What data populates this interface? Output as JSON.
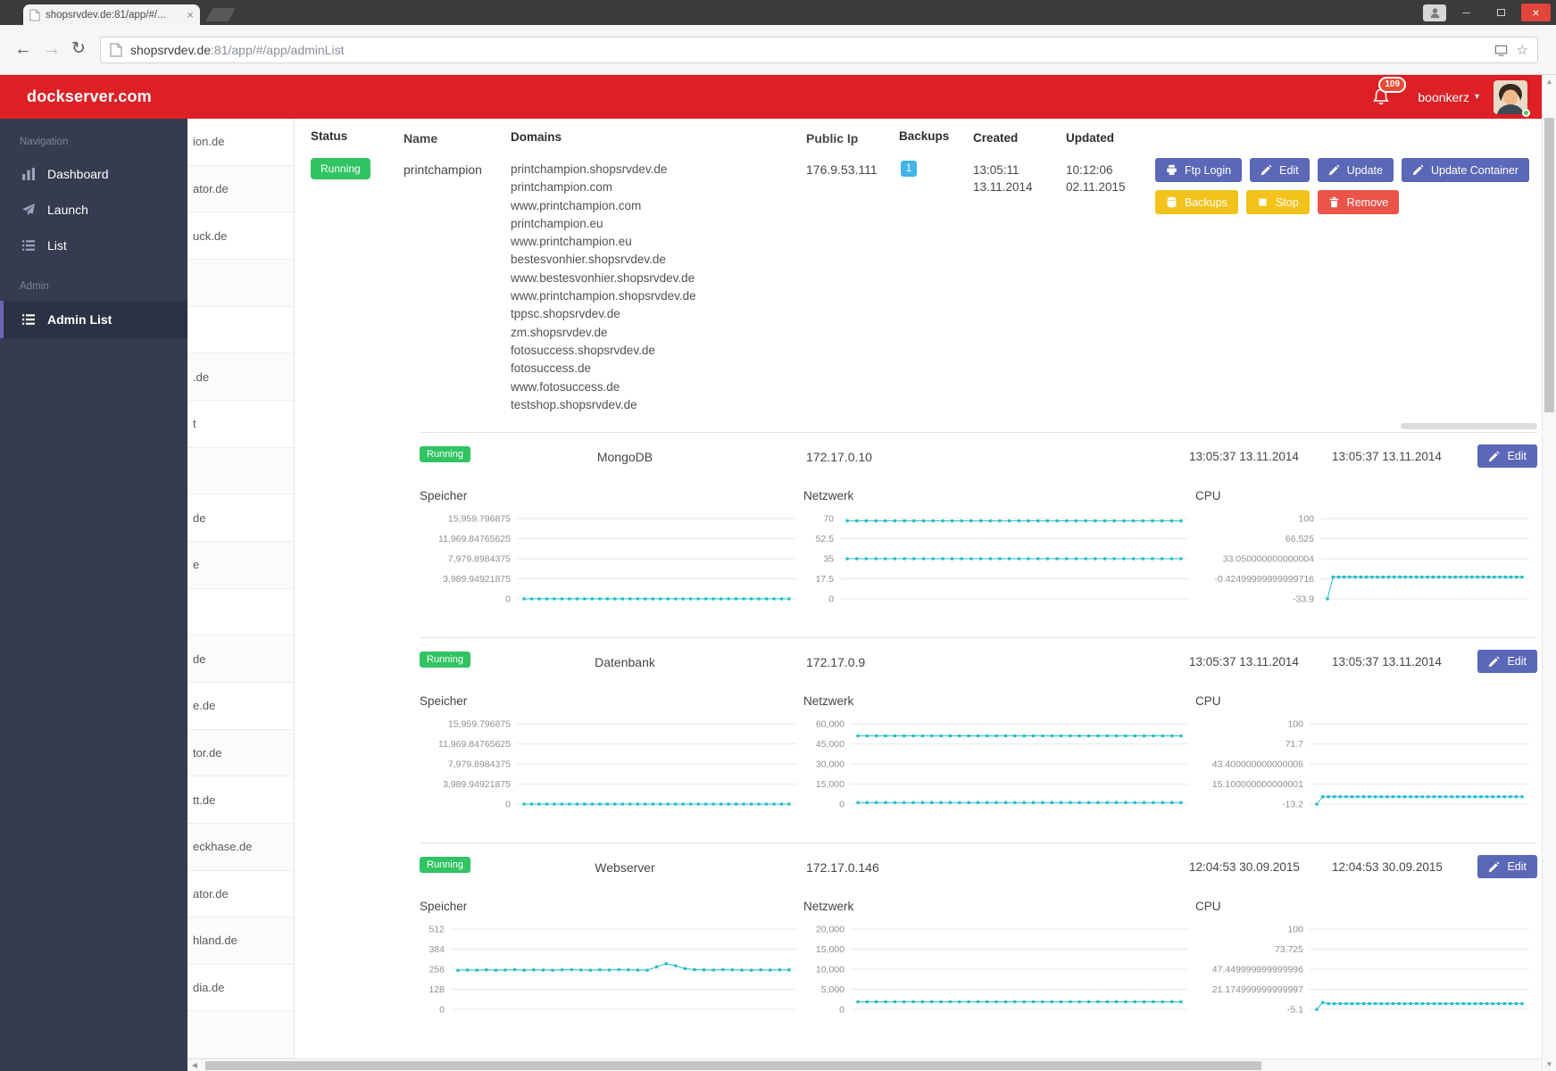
{
  "colors": {
    "brand_red": "#dd2025",
    "accent_purple": "#6f63b8",
    "button_purple": "#5b67b7",
    "button_yellow": "#f3c31c",
    "button_red": "#eb5449",
    "green": "#31c462",
    "teal": "#23bdc9",
    "backup_blue": "#43b5e8"
  },
  "browser": {
    "tab_title": "shopsrvdev.de:81/app/#/...",
    "url_host": "shopsrvdev.de",
    "url_rest": ":81/app/#/app/adminList"
  },
  "header": {
    "brand": "dockserver.com",
    "notification_count": "109",
    "user_name": "boonkerz"
  },
  "sidebar": {
    "sections": [
      {
        "label": "Navigation",
        "items": [
          {
            "label": "Dashboard",
            "icon": "dashboard",
            "active": false
          },
          {
            "label": "Launch",
            "icon": "launch",
            "active": false
          },
          {
            "label": "List",
            "icon": "list",
            "active": false
          }
        ]
      },
      {
        "label": "Admin",
        "items": [
          {
            "label": "Admin List",
            "icon": "list",
            "active": true
          }
        ]
      }
    ]
  },
  "app_list": [
    "ion.de",
    "ator.de",
    "uck.de",
    "",
    "",
    ".de",
    "t",
    "",
    "de",
    "e",
    "",
    "de",
    "e.de",
    "tor.de",
    "tt.de",
    "eckhase.de",
    "ator.de",
    "hland.de",
    "dia.de",
    ""
  ],
  "table": {
    "headers": [
      "Status",
      "Name",
      "Domains",
      "Public Ip",
      "Backups",
      "Created",
      "Updated"
    ],
    "row": {
      "status": "Running",
      "name": "printchampion",
      "domains": [
        "printchampion.shopsrvdev.de",
        "printchampion.com",
        "www.printchampion.com",
        "printchampion.eu",
        "www.printchampion.eu",
        "bestesvonhier.shopsrvdev.de",
        "www.bestesvonhier.shopsrvdev.de",
        "www.printchampion.shopsrvdev.de",
        "tppsc.shopsrvdev.de",
        "zm.shopsrvdev.de",
        "fotosuccess.shopsrvdev.de",
        "fotosuccess.de",
        "www.fotosuccess.de",
        "testshop.shopsrvdev.de"
      ],
      "public_ip": "176.9.53.111",
      "backups": "1",
      "created": [
        "13:05:11",
        "13.11.2014"
      ],
      "updated": [
        "10:12:06",
        "02.11.2015"
      ],
      "actions_row1": [
        {
          "label": "Ftp Login",
          "icon": "printer",
          "style": "purple"
        },
        {
          "label": "Edit",
          "icon": "pencil",
          "style": "purple"
        },
        {
          "label": "Update",
          "icon": "pencil",
          "style": "purple"
        },
        {
          "label": "Update Container",
          "icon": "pencil",
          "style": "purple"
        }
      ],
      "actions_row2": [
        {
          "label": "Backups",
          "icon": "database",
          "style": "yellow"
        },
        {
          "label": "Stop",
          "icon": "stop",
          "style": "yellow"
        },
        {
          "label": "Remove",
          "icon": "trash",
          "style": "red"
        }
      ]
    }
  },
  "containers": [
    {
      "status": "Running",
      "name": "MongoDB",
      "ip": "172.17.0.10",
      "created": "13:05:37 13.11.2014",
      "updated": "13:05:37 13.11.2014",
      "edit_label": "Edit",
      "charts": [
        {
          "title": "Speicher",
          "type": "line",
          "ymax": 15959.796875,
          "ymin": 0,
          "ticks": [
            "15,959.796875",
            "11,969.84765625",
            "7,979.8984375",
            "3,989.94921875",
            "0"
          ],
          "series": [
            [
              0,
              0,
              0,
              0,
              0,
              0,
              0,
              0,
              0,
              0,
              0,
              0,
              0,
              0,
              0,
              0,
              0,
              0,
              0,
              0,
              0,
              0,
              0,
              0,
              0,
              0,
              0,
              0,
              0,
              0,
              0,
              0,
              0,
              0,
              0,
              0
            ]
          ]
        },
        {
          "title": "Netzwerk",
          "type": "line",
          "ymax": 70,
          "ymin": 0,
          "ticks": [
            "70",
            "52.5",
            "35",
            "17.5",
            "0"
          ],
          "series": [
            [
              68,
              68,
              68,
              68,
              68,
              68,
              68,
              68,
              68,
              68,
              68,
              68,
              68,
              68,
              68,
              68,
              68,
              68,
              68,
              68,
              68,
              68,
              68,
              68,
              68,
              68,
              68,
              68,
              68,
              68,
              68,
              68,
              68,
              68,
              68,
              68
            ],
            [
              35,
              35,
              35,
              35,
              35,
              35,
              35,
              35,
              35,
              35,
              35,
              35,
              35,
              35,
              35,
              35,
              35,
              35,
              35,
              35,
              35,
              35,
              35,
              35,
              35,
              35,
              35,
              35,
              35,
              35,
              35,
              35,
              35,
              35,
              35,
              35
            ]
          ]
        },
        {
          "title": "CPU",
          "type": "line",
          "ymax": 100,
          "ymin": -33.9,
          "ticks": [
            "100",
            "66.525",
            "33.050000000000004",
            "-0.42499999999999716",
            "-33.9"
          ],
          "series": [
            [
              -33.9,
              2.5,
              2.5,
              2.5,
              2.5,
              2.5,
              2.5,
              2.5,
              2.5,
              2.5,
              2.5,
              2.5,
              2.5,
              2.5,
              2.5,
              2.5,
              2.5,
              2.5,
              2.5,
              2.5,
              2.5,
              2.5,
              2.5,
              2.5,
              2.5,
              2.5,
              2.5,
              2.5,
              2.5,
              2.5,
              2.5,
              2.5,
              2.5,
              2.5,
              2.5,
              2.5
            ]
          ]
        }
      ]
    },
    {
      "status": "Running",
      "name": "Datenbank",
      "ip": "172.17.0.9",
      "created": "13:05:37 13.11.2014",
      "updated": "13:05:37 13.11.2014",
      "edit_label": "Edit",
      "charts": [
        {
          "title": "Speicher",
          "type": "line",
          "ymax": 15959.796875,
          "ymin": 0,
          "ticks": [
            "15,959.796875",
            "11,969.84765625",
            "7,979.8984375",
            "3,989.94921875",
            "0"
          ],
          "series": [
            [
              0,
              0,
              0,
              0,
              0,
              0,
              0,
              0,
              0,
              0,
              0,
              0,
              0,
              0,
              0,
              0,
              0,
              0,
              0,
              0,
              0,
              0,
              0,
              0,
              0,
              0,
              0,
              0,
              0,
              0,
              0,
              0,
              0,
              0,
              0,
              0
            ]
          ]
        },
        {
          "title": "Netzwerk",
          "type": "line",
          "ymax": 60000,
          "ymin": 0,
          "ticks": [
            "60,000",
            "45,000",
            "30,000",
            "15,000",
            "0"
          ],
          "series": [
            [
              51000,
              51000,
              51000,
              51000,
              51000,
              51000,
              51000,
              51000,
              51000,
              51000,
              51000,
              51000,
              51000,
              51000,
              51000,
              51000,
              51000,
              51000,
              51000,
              51000,
              51000,
              51000,
              51000,
              51000,
              51000,
              51000,
              51000,
              51000,
              51000,
              51000,
              51000,
              51000,
              51000,
              51000,
              51000,
              51000
            ],
            [
              1200,
              1200,
              1200,
              1200,
              1200,
              1200,
              1200,
              1200,
              1200,
              1200,
              1200,
              1200,
              1200,
              1200,
              1200,
              1200,
              1200,
              1200,
              1200,
              1200,
              1200,
              1200,
              1200,
              1200,
              1200,
              1200,
              1200,
              1200,
              1200,
              1200,
              1200,
              1200,
              1200,
              1200,
              1200,
              1200
            ]
          ]
        },
        {
          "title": "CPU",
          "type": "line",
          "ymax": 100,
          "ymin": -13.2,
          "ticks": [
            "100",
            "71.7",
            "43.400000000000006",
            "15.100000000000001",
            "-13.2"
          ],
          "series": [
            [
              -13.2,
              -2.8,
              -2.8,
              -2.8,
              -2.8,
              -2.8,
              -2.8,
              -2.8,
              -2.8,
              -2.8,
              -2.8,
              -2.8,
              -2.8,
              -2.8,
              -2.8,
              -2.8,
              -2.8,
              -2.8,
              -2.8,
              -2.8,
              -2.8,
              -2.8,
              -2.8,
              -2.8,
              -2.8,
              -2.8,
              -2.8,
              -2.8,
              -2.8,
              -2.8,
              -2.8,
              -2.8,
              -2.8,
              -2.8,
              -2.8,
              -2.8
            ]
          ]
        }
      ]
    },
    {
      "status": "Running",
      "name": "Webserver",
      "ip": "172.17.0.146",
      "created": "12:04:53 30.09.2015",
      "updated": "12:04:53 30.09.2015",
      "edit_label": "Edit",
      "charts": [
        {
          "title": "Speicher",
          "type": "line",
          "ymax": 512,
          "ymin": 0,
          "ticks": [
            "512",
            "384",
            "256",
            "128",
            "0"
          ],
          "series": [
            [
              249,
              251,
              250,
              252,
              250,
              251,
              253,
              250,
              252,
              251,
              250,
              252,
              253,
              251,
              250,
              252,
              251,
              253,
              252,
              251,
              250,
              272,
              291,
              278,
              260,
              254,
              252,
              251,
              253,
              252,
              251,
              250,
              252,
              251,
              252,
              252
            ]
          ]
        },
        {
          "title": "Netzwerk",
          "type": "line",
          "ymax": 20000,
          "ymin": 0,
          "ticks": [
            "20,000",
            "15,000",
            "10,000",
            "5,000",
            "0"
          ],
          "series": [
            [
              1900,
              1900,
              1900,
              1900,
              1900,
              1900,
              1900,
              1900,
              1900,
              1900,
              1900,
              1900,
              1900,
              1900,
              1900,
              1900,
              1900,
              1900,
              1900,
              1900,
              1900,
              1900,
              1900,
              1900,
              1900,
              1900,
              1900,
              1900,
              1900,
              1900,
              1900,
              1900,
              1900,
              1900,
              1900,
              1900
            ]
          ]
        },
        {
          "title": "CPU",
          "type": "line",
          "ymax": 100,
          "ymin": -5.1,
          "ticks": [
            "100",
            "73.725",
            "47.449999999999996",
            "21.174999999999997",
            "-5.1"
          ],
          "series": [
            [
              -5.1,
              4,
              2.4,
              2.4,
              2.4,
              2.4,
              2.4,
              2.4,
              2.4,
              2.4,
              2.4,
              2.4,
              2.4,
              2.4,
              2.4,
              2.4,
              2.4,
              2.4,
              2.4,
              2.4,
              2.4,
              2.4,
              2.4,
              2.4,
              2.4,
              2.4,
              2.4,
              2.4,
              2.4,
              2.4,
              2.4,
              2.4,
              2.4,
              2.4,
              2.4,
              2.4
            ]
          ]
        }
      ]
    }
  ]
}
